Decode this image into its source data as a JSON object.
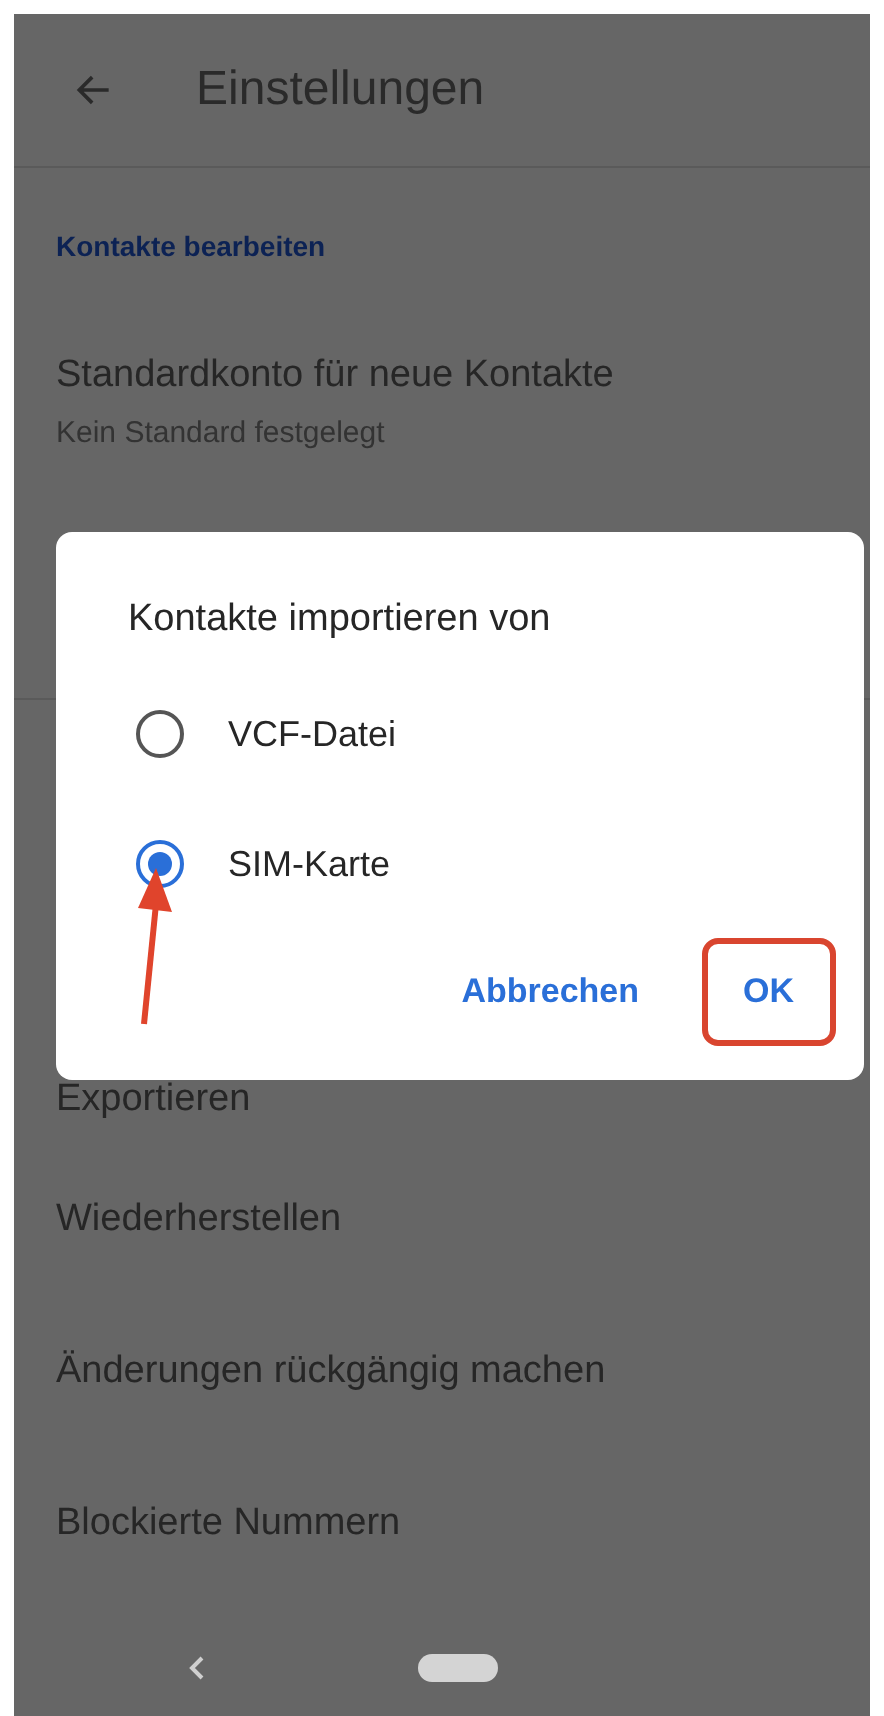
{
  "app_bar": {
    "title": "Einstellungen"
  },
  "section": {
    "header": "Kontakte bearbeiten"
  },
  "settings": [
    {
      "title": "Standardkonto für neue Kontakte",
      "subtitle": "Kein Standard festgelegt"
    },
    {
      "title": "Exportieren"
    },
    {
      "title": "Wiederherstellen"
    },
    {
      "title": "Änderungen rückgängig machen"
    },
    {
      "title": "Blockierte Nummern"
    }
  ],
  "dialog": {
    "title": "Kontakte importieren von",
    "options": [
      {
        "label": "VCF-Datei",
        "selected": false
      },
      {
        "label": "SIM-Karte",
        "selected": true
      }
    ],
    "buttons": [
      {
        "label": "Abbrechen",
        "highlighted": false
      },
      {
        "label": "OK",
        "highlighted": true
      }
    ]
  }
}
